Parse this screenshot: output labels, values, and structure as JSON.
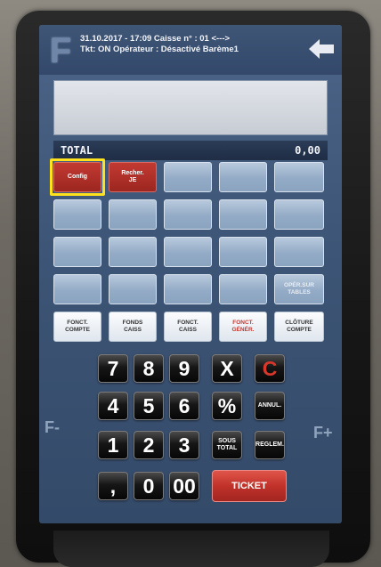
{
  "header": {
    "logo": "F",
    "line1": "31.10.2017 - 17:09   Caisse n° : 01 <--->",
    "line2": "Tkt: ON Opérateur : Désactivé  Barème1",
    "back_icon": "arrow-left-icon"
  },
  "total": {
    "label": "TOTAL",
    "value": "0,00"
  },
  "grid": {
    "config": "Config",
    "recherche": "Recher.\nJE",
    "oper_sur_tables": "OPÉR.SUR\nTABLES",
    "fonct_compte": "FONCT.\nCOMPTE",
    "fonds_caiss": "FONDS\nCAISS",
    "fonct_caiss": "FONCT.\nCAISS",
    "fonct_gener": "FONCT.\nGÉNÉR.",
    "cloture_compte": "CLÔTURE\nCOMPTE"
  },
  "keypad": {
    "k7": "7",
    "k8": "8",
    "k9": "9",
    "kx": "X",
    "kc": "C",
    "k4": "4",
    "k5": "5",
    "k6": "6",
    "kpct": "%",
    "annul": "ANNUL.",
    "k1": "1",
    "k2": "2",
    "k3": "3",
    "sous_total": "SOUS\nTOTAL",
    "reglem": "REGLEM.",
    "kcomma": ",",
    "k0": "0",
    "k00": "00",
    "ticket": "TICKET"
  },
  "side": {
    "f_minus": "F-",
    "f_plus": "F+"
  },
  "colors": {
    "accent_red": "#c0322a",
    "highlight": "#ffe21c",
    "screen_blue": "#3d5576"
  }
}
